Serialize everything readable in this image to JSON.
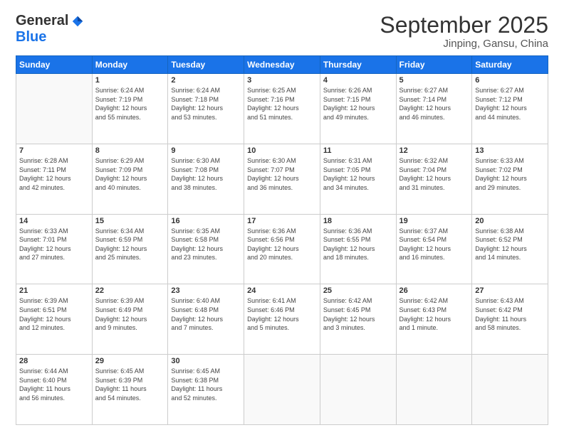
{
  "logo": {
    "general": "General",
    "blue": "Blue"
  },
  "header": {
    "month": "September 2025",
    "location": "Jinping, Gansu, China"
  },
  "weekdays": [
    "Sunday",
    "Monday",
    "Tuesday",
    "Wednesday",
    "Thursday",
    "Friday",
    "Saturday"
  ],
  "weeks": [
    [
      {
        "day": "",
        "info": ""
      },
      {
        "day": "1",
        "info": "Sunrise: 6:24 AM\nSunset: 7:19 PM\nDaylight: 12 hours\nand 55 minutes."
      },
      {
        "day": "2",
        "info": "Sunrise: 6:24 AM\nSunset: 7:18 PM\nDaylight: 12 hours\nand 53 minutes."
      },
      {
        "day": "3",
        "info": "Sunrise: 6:25 AM\nSunset: 7:16 PM\nDaylight: 12 hours\nand 51 minutes."
      },
      {
        "day": "4",
        "info": "Sunrise: 6:26 AM\nSunset: 7:15 PM\nDaylight: 12 hours\nand 49 minutes."
      },
      {
        "day": "5",
        "info": "Sunrise: 6:27 AM\nSunset: 7:14 PM\nDaylight: 12 hours\nand 46 minutes."
      },
      {
        "day": "6",
        "info": "Sunrise: 6:27 AM\nSunset: 7:12 PM\nDaylight: 12 hours\nand 44 minutes."
      }
    ],
    [
      {
        "day": "7",
        "info": "Sunrise: 6:28 AM\nSunset: 7:11 PM\nDaylight: 12 hours\nand 42 minutes."
      },
      {
        "day": "8",
        "info": "Sunrise: 6:29 AM\nSunset: 7:09 PM\nDaylight: 12 hours\nand 40 minutes."
      },
      {
        "day": "9",
        "info": "Sunrise: 6:30 AM\nSunset: 7:08 PM\nDaylight: 12 hours\nand 38 minutes."
      },
      {
        "day": "10",
        "info": "Sunrise: 6:30 AM\nSunset: 7:07 PM\nDaylight: 12 hours\nand 36 minutes."
      },
      {
        "day": "11",
        "info": "Sunrise: 6:31 AM\nSunset: 7:05 PM\nDaylight: 12 hours\nand 34 minutes."
      },
      {
        "day": "12",
        "info": "Sunrise: 6:32 AM\nSunset: 7:04 PM\nDaylight: 12 hours\nand 31 minutes."
      },
      {
        "day": "13",
        "info": "Sunrise: 6:33 AM\nSunset: 7:02 PM\nDaylight: 12 hours\nand 29 minutes."
      }
    ],
    [
      {
        "day": "14",
        "info": "Sunrise: 6:33 AM\nSunset: 7:01 PM\nDaylight: 12 hours\nand 27 minutes."
      },
      {
        "day": "15",
        "info": "Sunrise: 6:34 AM\nSunset: 6:59 PM\nDaylight: 12 hours\nand 25 minutes."
      },
      {
        "day": "16",
        "info": "Sunrise: 6:35 AM\nSunset: 6:58 PM\nDaylight: 12 hours\nand 23 minutes."
      },
      {
        "day": "17",
        "info": "Sunrise: 6:36 AM\nSunset: 6:56 PM\nDaylight: 12 hours\nand 20 minutes."
      },
      {
        "day": "18",
        "info": "Sunrise: 6:36 AM\nSunset: 6:55 PM\nDaylight: 12 hours\nand 18 minutes."
      },
      {
        "day": "19",
        "info": "Sunrise: 6:37 AM\nSunset: 6:54 PM\nDaylight: 12 hours\nand 16 minutes."
      },
      {
        "day": "20",
        "info": "Sunrise: 6:38 AM\nSunset: 6:52 PM\nDaylight: 12 hours\nand 14 minutes."
      }
    ],
    [
      {
        "day": "21",
        "info": "Sunrise: 6:39 AM\nSunset: 6:51 PM\nDaylight: 12 hours\nand 12 minutes."
      },
      {
        "day": "22",
        "info": "Sunrise: 6:39 AM\nSunset: 6:49 PM\nDaylight: 12 hours\nand 9 minutes."
      },
      {
        "day": "23",
        "info": "Sunrise: 6:40 AM\nSunset: 6:48 PM\nDaylight: 12 hours\nand 7 minutes."
      },
      {
        "day": "24",
        "info": "Sunrise: 6:41 AM\nSunset: 6:46 PM\nDaylight: 12 hours\nand 5 minutes."
      },
      {
        "day": "25",
        "info": "Sunrise: 6:42 AM\nSunset: 6:45 PM\nDaylight: 12 hours\nand 3 minutes."
      },
      {
        "day": "26",
        "info": "Sunrise: 6:42 AM\nSunset: 6:43 PM\nDaylight: 12 hours\nand 1 minute."
      },
      {
        "day": "27",
        "info": "Sunrise: 6:43 AM\nSunset: 6:42 PM\nDaylight: 11 hours\nand 58 minutes."
      }
    ],
    [
      {
        "day": "28",
        "info": "Sunrise: 6:44 AM\nSunset: 6:40 PM\nDaylight: 11 hours\nand 56 minutes."
      },
      {
        "day": "29",
        "info": "Sunrise: 6:45 AM\nSunset: 6:39 PM\nDaylight: 11 hours\nand 54 minutes."
      },
      {
        "day": "30",
        "info": "Sunrise: 6:45 AM\nSunset: 6:38 PM\nDaylight: 11 hours\nand 52 minutes."
      },
      {
        "day": "",
        "info": ""
      },
      {
        "day": "",
        "info": ""
      },
      {
        "day": "",
        "info": ""
      },
      {
        "day": "",
        "info": ""
      }
    ]
  ]
}
